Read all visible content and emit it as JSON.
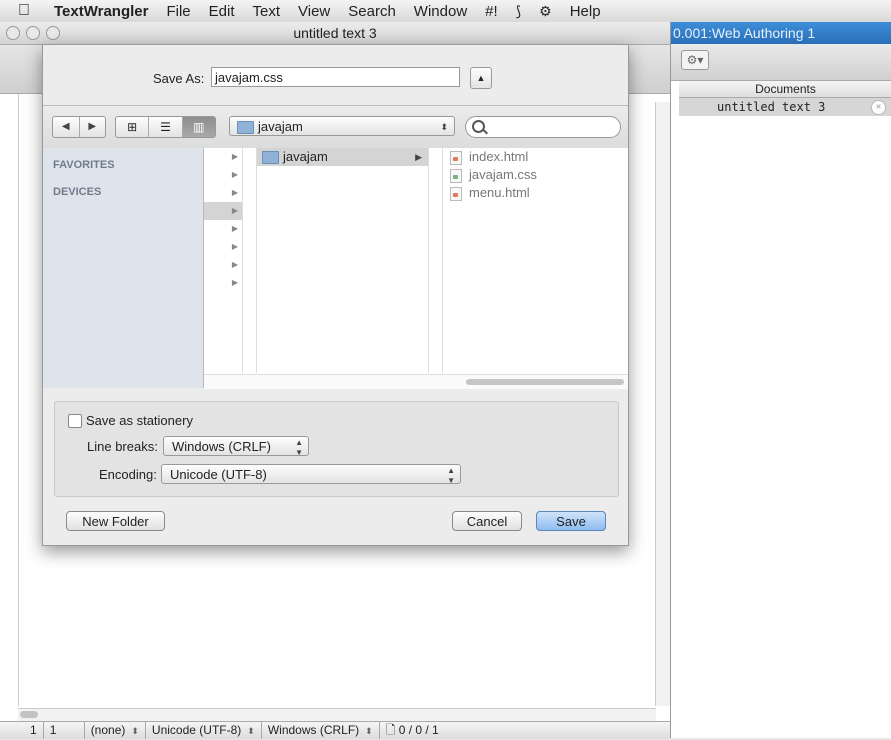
{
  "menubar": {
    "apple": "",
    "app": "TextWrangler",
    "items": [
      "File",
      "Edit",
      "Text",
      "View",
      "Search",
      "Window",
      "#!",
      "⟆",
      "⚙",
      "Help"
    ]
  },
  "background_window": {
    "title": "0.001:Web Authoring 1",
    "gear_label": "⚙▾",
    "documents_header": "Documents",
    "document_item": "untitled text 3",
    "close_icon": "✕"
  },
  "main_window": {
    "title": "untitled text 3"
  },
  "statusbar": {
    "line": "1",
    "col": "1",
    "language": "(none)",
    "encoding": "Unicode (UTF-8)",
    "line_breaks": "Windows (CRLF)",
    "counts": "0 / 0 / 1"
  },
  "save_sheet": {
    "save_as_label": "Save As:",
    "save_as_value": "javajam.css",
    "expand_icon": "▲",
    "nav_back": "◀",
    "nav_forward": "▶",
    "view_icons": [
      "⊞",
      "☰",
      "▥"
    ],
    "location": "javajam",
    "search_placeholder": "",
    "sidebar_headings": [
      "FAVORITES",
      "DEVICES"
    ],
    "column2_item": "javajam",
    "files": [
      "index.html",
      "javajam.css",
      "menu.html"
    ],
    "stationery_label": "Save as stationery",
    "line_breaks_label": "Line breaks:",
    "line_breaks_value": "Windows (CRLF)",
    "encoding_label": "Encoding:",
    "encoding_value": "Unicode (UTF-8)",
    "new_folder": "New Folder",
    "cancel": "Cancel",
    "save": "Save"
  },
  "colors": {
    "default_button": "#8ebcef",
    "sidebar": "#dfe4ec",
    "background_title": "#2a6fb8"
  }
}
